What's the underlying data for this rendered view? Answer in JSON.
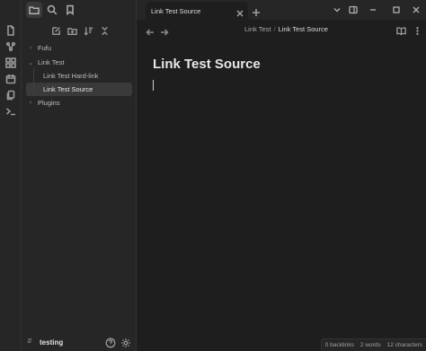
{
  "ribbon": {
    "icons": [
      "file-icon",
      "graph-icon",
      "blocks-icon",
      "calendar-icon",
      "copy-icon",
      "terminal-icon"
    ]
  },
  "sidebar": {
    "tree": [
      {
        "label": "Fufu",
        "type": "folder",
        "expanded": false
      },
      {
        "label": "Link Test",
        "type": "folder",
        "expanded": true
      },
      {
        "label": "Link Test Hard-link",
        "type": "file"
      },
      {
        "label": "Link Test Source",
        "type": "file",
        "selected": true
      },
      {
        "label": "Plugins",
        "type": "folder",
        "expanded": false
      }
    ],
    "vault_name": "testing"
  },
  "tabs": [
    {
      "title": "Link Test Source",
      "active": true
    }
  ],
  "editor": {
    "breadcrumb": {
      "parent": "Link Test",
      "separator": "/",
      "current": "Link Test Source"
    },
    "note_title": "Link Test Source"
  },
  "status": {
    "backlinks": "0 backlinks",
    "words": "2 words",
    "characters": "12 characters"
  }
}
